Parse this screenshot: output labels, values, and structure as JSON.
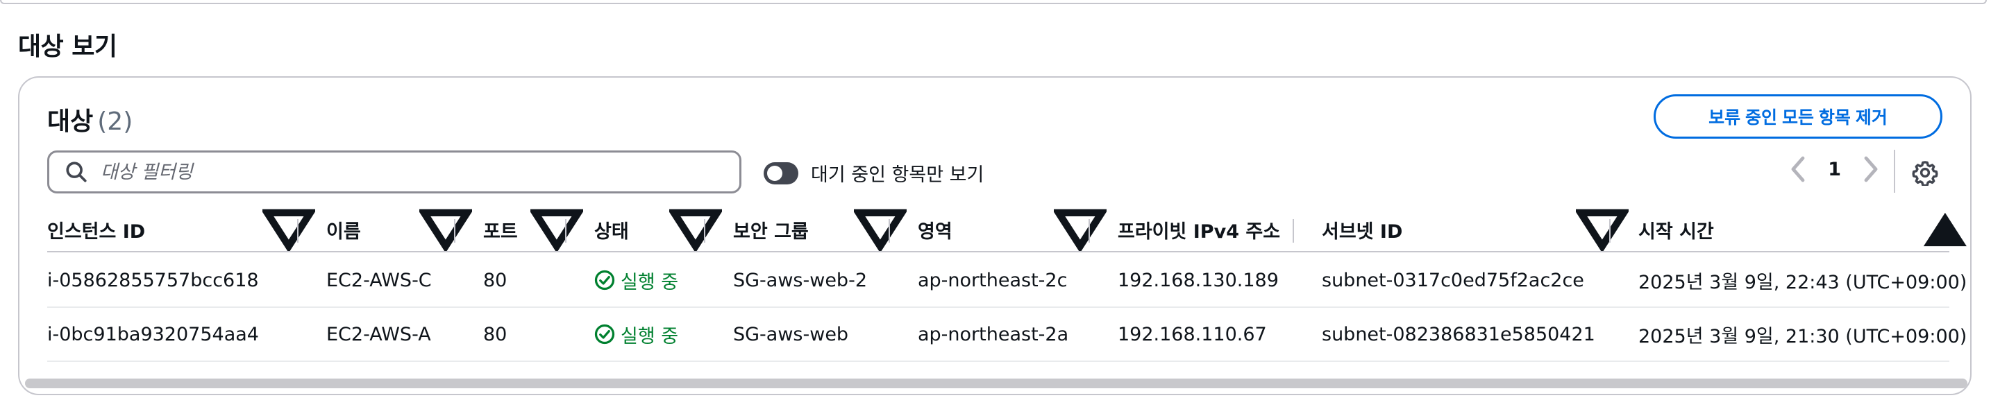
{
  "section": {
    "title": "대상 보기"
  },
  "card": {
    "title": "대상",
    "count": "(2)",
    "remove_button": "보류 중인 모든 항목 제거"
  },
  "search": {
    "placeholder": "대상 필터링",
    "value": ""
  },
  "toggle": {
    "label": "대기 중인 항목만 보기",
    "on": false
  },
  "pagination": {
    "current": "1"
  },
  "icons": {
    "search": "search-icon",
    "toggle": "toggle-switch",
    "prev": "chevron-left-icon",
    "next": "chevron-right-icon",
    "settings": "gear-icon",
    "sort": "caret-down-icon",
    "sort_active": "caret-up-icon",
    "status": "check-circle-icon"
  },
  "colors": {
    "accent": "#006ce0",
    "success": "#00802f",
    "text": "#0f141a",
    "border": "#c6c6cd"
  },
  "table": {
    "columns": [
      {
        "label": "인스턴스 ID"
      },
      {
        "label": "이름"
      },
      {
        "label": "포트"
      },
      {
        "label": "상태"
      },
      {
        "label": "보안 그룹"
      },
      {
        "label": "영역"
      },
      {
        "label": "프라이빗 IPv4 주소"
      },
      {
        "label": "서브넷 ID"
      },
      {
        "label": "시작 시간"
      }
    ],
    "rows": [
      {
        "instance_id": "i-05862855757bcc618",
        "name": "EC2-AWS-C",
        "port": "80",
        "status": "실행 중",
        "security_group": "SG-aws-web-2",
        "zone": "ap-northeast-2c",
        "private_ip": "192.168.130.189",
        "subnet_id": "subnet-0317c0ed75f2ac2ce",
        "start_time": "2025년 3월 9일, 22:43 (UTC+09:00)"
      },
      {
        "instance_id": "i-0bc91ba9320754aa4",
        "name": "EC2-AWS-A",
        "port": "80",
        "status": "실행 중",
        "security_group": "SG-aws-web",
        "zone": "ap-northeast-2a",
        "private_ip": "192.168.110.67",
        "subnet_id": "subnet-082386831e5850421",
        "start_time": "2025년 3월 9일, 21:30 (UTC+09:00)"
      }
    ]
  }
}
